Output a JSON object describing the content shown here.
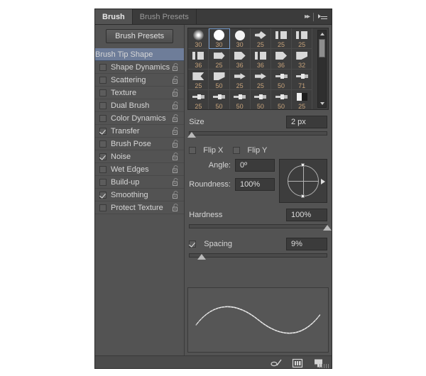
{
  "panel": {
    "tabs": [
      {
        "label": "Brush",
        "active": true
      },
      {
        "label": "Brush Presets",
        "active": false
      }
    ],
    "collapse_icon": "double-chevron-right-icon",
    "menu_icon": "panel-menu-icon",
    "presets_button": "Brush Presets"
  },
  "options": [
    {
      "label": "Brush Tip Shape",
      "type": "header",
      "checked": null,
      "lock": false
    },
    {
      "label": "Shape Dynamics",
      "type": "item",
      "checked": false,
      "lock": true
    },
    {
      "label": "Scattering",
      "type": "item",
      "checked": false,
      "lock": true
    },
    {
      "label": "Texture",
      "type": "item",
      "checked": false,
      "lock": true
    },
    {
      "label": "Dual Brush",
      "type": "item",
      "checked": false,
      "lock": true
    },
    {
      "label": "Color Dynamics",
      "type": "item",
      "checked": false,
      "lock": true
    },
    {
      "label": "Transfer",
      "type": "item",
      "checked": true,
      "lock": true
    },
    {
      "label": "Brush Pose",
      "type": "item",
      "checked": false,
      "lock": true
    },
    {
      "label": "Noise",
      "type": "item",
      "checked": true,
      "lock": true
    },
    {
      "label": "Wet Edges",
      "type": "item",
      "checked": false,
      "lock": true
    },
    {
      "label": "Build-up",
      "type": "item",
      "checked": false,
      "lock": true
    },
    {
      "label": "Smoothing",
      "type": "item",
      "checked": true,
      "lock": true
    },
    {
      "label": "Protect Texture",
      "type": "item",
      "checked": false,
      "lock": true
    }
  ],
  "brush_grid": {
    "selected_index": 1,
    "cells": [
      {
        "size": "30",
        "shape": "soft-round"
      },
      {
        "size": "30",
        "shape": "hard-round"
      },
      {
        "size": "30",
        "shape": "hard-round-2"
      },
      {
        "size": "25",
        "shape": "flat-angle"
      },
      {
        "size": "25",
        "shape": "flat-block"
      },
      {
        "size": "25",
        "shape": "flat-block"
      },
      {
        "size": "36",
        "shape": "flat-fan"
      },
      {
        "size": "25",
        "shape": "bristle"
      },
      {
        "size": "36",
        "shape": "chisel"
      },
      {
        "size": "36",
        "shape": "square-flat"
      },
      {
        "size": "36",
        "shape": "round-flat"
      },
      {
        "size": "32",
        "shape": "angled-flat"
      },
      {
        "size": "25",
        "shape": "cone"
      },
      {
        "size": "50",
        "shape": "wedge"
      },
      {
        "size": "25",
        "shape": "arrow-flat"
      },
      {
        "size": "25",
        "shape": "arrow-flat"
      },
      {
        "size": "50",
        "shape": "pencil"
      },
      {
        "size": "71",
        "shape": "pencil"
      },
      {
        "size": "25",
        "shape": "pencil"
      },
      {
        "size": "50",
        "shape": "pencil"
      },
      {
        "size": "50",
        "shape": "pencil"
      },
      {
        "size": "50",
        "shape": "pencil"
      },
      {
        "size": "50",
        "shape": "pencil"
      },
      {
        "size": "25",
        "shape": "square-half"
      }
    ],
    "scroll_up_icon": "scroll-up-arrow-icon",
    "scroll_down_icon": "scroll-down-arrow-icon"
  },
  "controls": {
    "size": {
      "label": "Size",
      "value": "2 px",
      "slider_percent": 2
    },
    "flip_x": {
      "label": "Flip X",
      "checked": false
    },
    "flip_y": {
      "label": "Flip Y",
      "checked": false
    },
    "angle": {
      "label": "Angle:",
      "value": "0º"
    },
    "roundness": {
      "label": "Roundness:",
      "value": "100%"
    },
    "hardness": {
      "label": "Hardness",
      "value": "100%",
      "slider_percent": 100
    },
    "spacing": {
      "label": "Spacing",
      "value": "9%",
      "checked": true,
      "slider_percent": 9
    }
  },
  "footer": {
    "icons": [
      {
        "name": "toggle-brush-pressure-icon"
      },
      {
        "name": "brush-presets-panel-icon"
      },
      {
        "name": "new-brush-icon"
      }
    ],
    "resize_grip": "resize-grip-icon"
  },
  "preview": {
    "name": "brush-stroke-preview"
  }
}
